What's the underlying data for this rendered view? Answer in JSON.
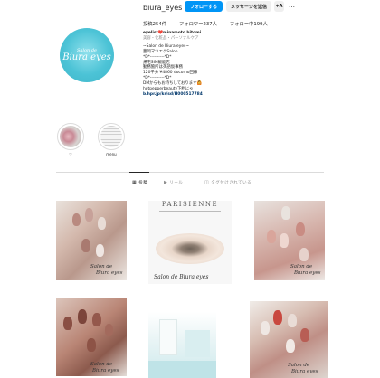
{
  "profile": {
    "username": "biura_eyes",
    "follow_label": "フォローする",
    "message_label": "メッセージを送信",
    "suggest_label": "+A",
    "more_label": "…",
    "avatar_text_1": "Salon de",
    "avatar_text_2": "Biura eyes"
  },
  "stats": {
    "posts": "投稿254件",
    "followers": "フォロワー237人",
    "following": "フォロー中199人"
  },
  "bio": {
    "name": "eyelist❤️minamoto hitomi",
    "category": "美容・化粧品・パーソナルケア",
    "lines": [
      "~Salon de Biura eyes~",
      "豊岡マツエクSalon",
      "*D*----------*D*",
      "帰宅SIM飯能店",
      "勤務箇所は英語仮事務",
      "120千分 ¥4860 docomo回線",
      "*D*----------*D*",
      "DMからもお待ちしております🙆"
    ],
    "link_1": "hotpepperbeauty下約にゃ",
    "link_2": "b.hpr.jp/kr/sd/H000517784"
  },
  "highlights": [
    {
      "label": "♡"
    },
    {
      "label": "menu"
    }
  ],
  "tabs": [
    {
      "label": "投稿",
      "icon": "grid-icon"
    },
    {
      "label": "リール",
      "icon": "reels-icon"
    },
    {
      "label": "タグ付けされている",
      "icon": "tag-icon"
    }
  ],
  "posts": {
    "p1_caption_1": "Salon de",
    "p1_caption_2": "Biura eyes",
    "p2_brand": "PARISIENNE",
    "p2_caption": "Salon de Biura eyes",
    "p3_caption_1": "Salon de",
    "p3_caption_2": "Biura eyes",
    "p4_caption_1": "Salon de",
    "p4_caption_2": "Biura eyes",
    "p6_caption_1": "Salon de",
    "p6_caption_2": "Biura eyes"
  },
  "colors": {
    "accent": "#0095f6",
    "avatar": "#4cc3d6",
    "link": "#00376b"
  }
}
